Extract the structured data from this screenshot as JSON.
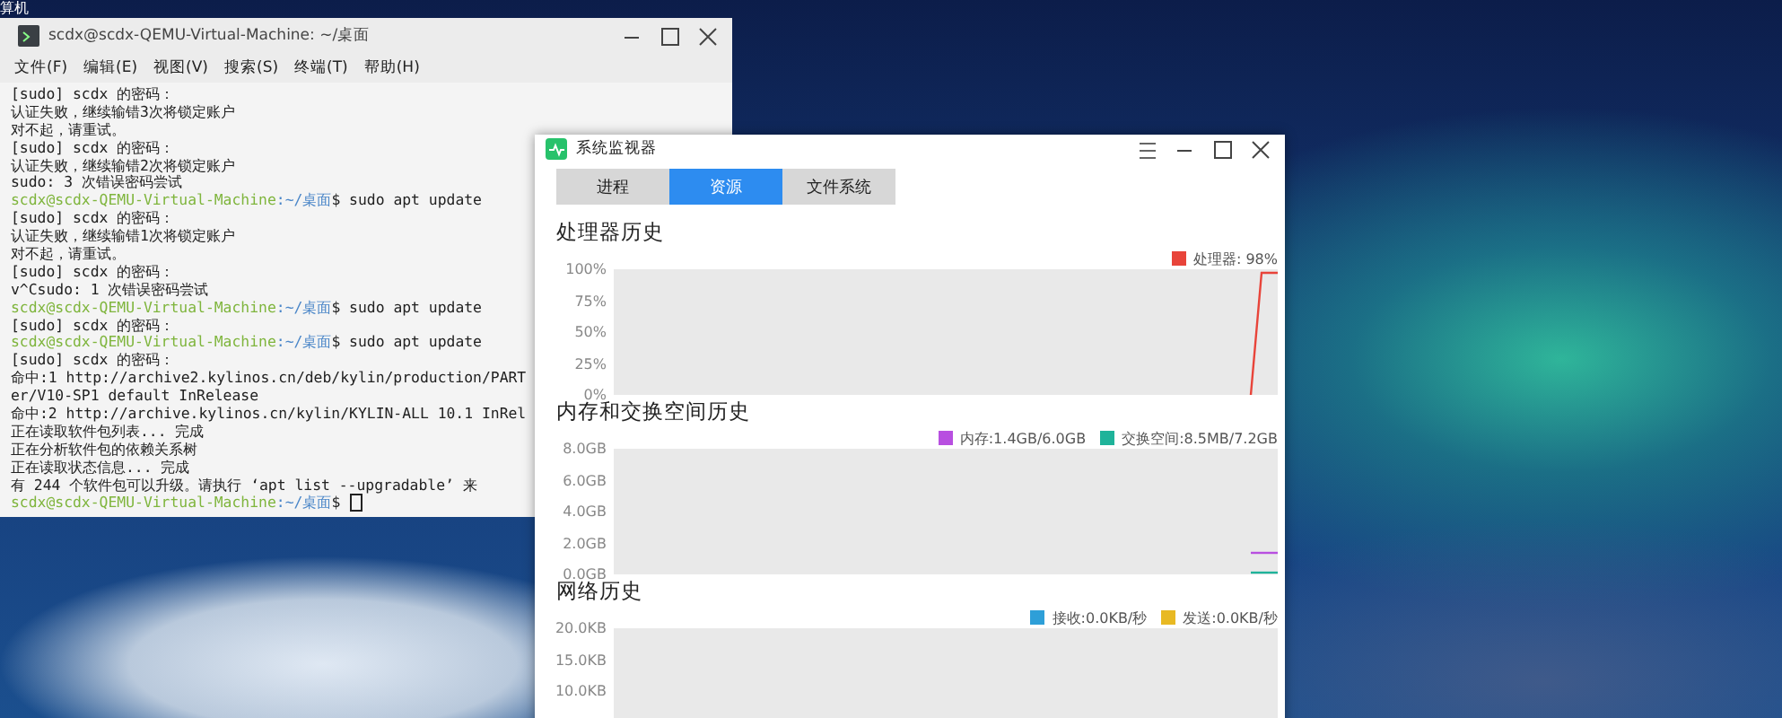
{
  "desktop": {
    "icon_label": "算机"
  },
  "terminal": {
    "title": "scdx@scdx-QEMU-Virtual-Machine: ~/桌面",
    "menu": [
      "文件(F)",
      "编辑(E)",
      "视图(V)",
      "搜索(S)",
      "终端(T)",
      "帮助(H)"
    ],
    "lines": [
      {
        "kind": "output",
        "text": "[sudo] scdx 的密码："
      },
      {
        "kind": "output",
        "text": "认证失败，继续输错3次将锁定账户"
      },
      {
        "kind": "output",
        "text": "对不起，请重试。"
      },
      {
        "kind": "output",
        "text": "[sudo] scdx 的密码："
      },
      {
        "kind": "output",
        "text": "认证失败，继续输错2次将锁定账户"
      },
      {
        "kind": "output",
        "text": "sudo: 3 次错误密码尝试"
      },
      {
        "kind": "prompt",
        "host": "scdx@scdx-QEMU-Virtual-Machine",
        "path": ":~/桌面",
        "text": "$ sudo apt update"
      },
      {
        "kind": "output",
        "text": "[sudo] scdx 的密码："
      },
      {
        "kind": "output",
        "text": "认证失败，继续输错1次将锁定账户"
      },
      {
        "kind": "output",
        "text": "对不起，请重试。"
      },
      {
        "kind": "output",
        "text": "[sudo] scdx 的密码："
      },
      {
        "kind": "output",
        "text": "v^Csudo: 1 次错误密码尝试"
      },
      {
        "kind": "prompt",
        "host": "scdx@scdx-QEMU-Virtual-Machine",
        "path": ":~/桌面",
        "text": "$ sudo apt update"
      },
      {
        "kind": "output",
        "text": "[sudo] scdx 的密码："
      },
      {
        "kind": "prompt",
        "host": "scdx@scdx-QEMU-Virtual-Machine",
        "path": ":~/桌面",
        "text": "$ sudo apt update"
      },
      {
        "kind": "output",
        "text": "[sudo] scdx 的密码："
      },
      {
        "kind": "output",
        "text": "命中:1 http://archive2.kylinos.cn/deb/kylin/production/PART"
      },
      {
        "kind": "output",
        "text": "er/V10-SP1 default InRelease"
      },
      {
        "kind": "output",
        "text": "命中:2 http://archive.kylinos.cn/kylin/KYLIN-ALL 10.1 InRel"
      },
      {
        "kind": "output",
        "text": "正在读取软件包列表... 完成"
      },
      {
        "kind": "output",
        "text": "正在分析软件包的依赖关系树"
      },
      {
        "kind": "output",
        "text": "正在读取状态信息... 完成"
      },
      {
        "kind": "output",
        "text": "有 244 个软件包可以升级。请执行 ‘apt list --upgradable’ 来"
      },
      {
        "kind": "prompt",
        "host": "scdx@scdx-QEMU-Virtual-Machine",
        "path": ":~/桌面",
        "text": "$ ",
        "cursor": true
      }
    ]
  },
  "monitor": {
    "title": "系统监视器",
    "tabs": [
      {
        "label": "进程",
        "selected": false
      },
      {
        "label": "资源",
        "selected": true
      },
      {
        "label": "文件系统",
        "selected": false
      }
    ],
    "sections": [
      {
        "kind": "cpu",
        "title": "处理器历史",
        "legend": [
          {
            "label": "处理器: 98%",
            "color": "#e8443a"
          }
        ],
        "axis_labels": [
          "100%",
          "75%",
          "50%",
          "25%",
          "0%"
        ]
      },
      {
        "kind": "memory",
        "title": "内存和交换空间历史",
        "legend": [
          {
            "label": "内存:1.4GB/6.0GB",
            "color": "#b84fe0"
          },
          {
            "label": "交换空间:8.5MB/7.2GB",
            "color": "#1fb39a"
          }
        ],
        "axis_labels": [
          "8.0GB",
          "6.0GB",
          "4.0GB",
          "2.0GB",
          "0.0GB"
        ]
      },
      {
        "kind": "network",
        "title": "网络历史",
        "legend": [
          {
            "label": "接收:0.0KB/秒",
            "color": "#2e9fd8"
          },
          {
            "label": "发送:0.0KB/秒",
            "color": "#e8b923"
          }
        ],
        "axis_labels": [
          "20.0KB",
          "15.0KB",
          "10.0KB"
        ]
      }
    ]
  }
}
